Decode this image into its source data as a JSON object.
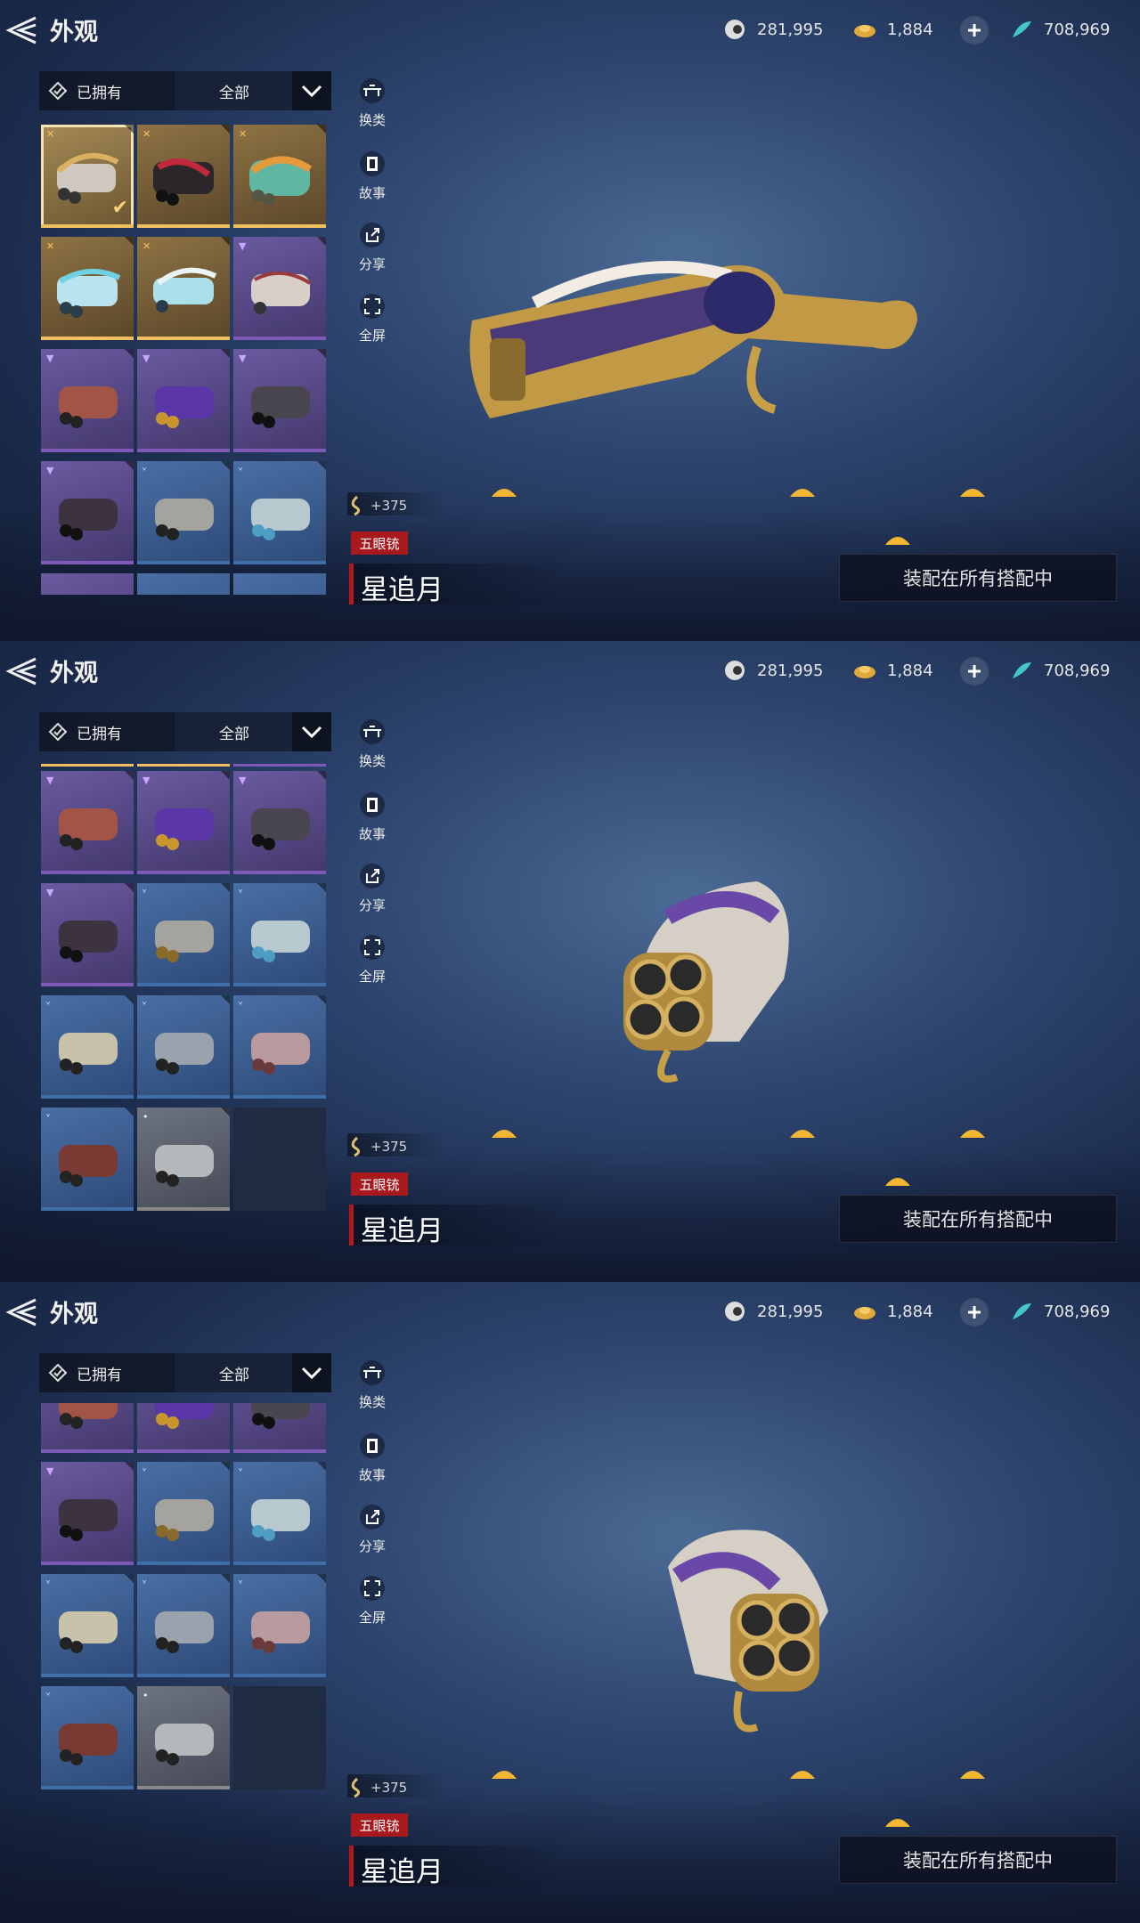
{
  "header": {
    "title": "外观",
    "currencies": [
      {
        "icon": "coin-swirl-icon",
        "value": "281,995"
      },
      {
        "icon": "gold-ingot-icon",
        "value": "1,884"
      },
      {
        "icon": "jade-feather-icon",
        "value": "708,969"
      }
    ],
    "add_icon": "plus-icon"
  },
  "filter": {
    "owned_label": "已拥有",
    "category_label": "全部"
  },
  "side_actions": [
    {
      "icon": "swap-icon",
      "label": "换类"
    },
    {
      "icon": "book-icon",
      "label": "故事"
    },
    {
      "icon": "share-icon",
      "label": "分享"
    },
    {
      "icon": "fullscreen-icon",
      "label": "全屏"
    }
  ],
  "item": {
    "power": "+375",
    "type_tag": "五眼铳",
    "name": "星追月",
    "equip_button": "装配在所有搭配中"
  },
  "colors": {
    "gold": "#f0c060",
    "purple": "#7d5ab8",
    "blue": "#3f6ea8",
    "white": "#888"
  }
}
